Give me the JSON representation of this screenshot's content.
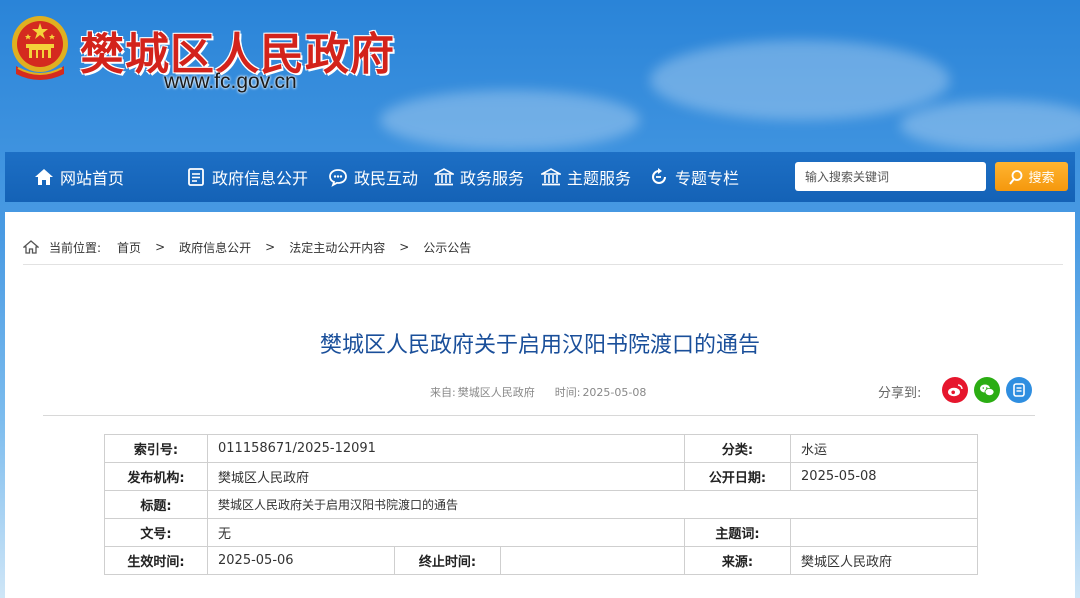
{
  "header": {
    "site_name": "樊城区人民政府",
    "domain": "www.fc.gov.cn",
    "brand_color": "#d3231b"
  },
  "nav": {
    "items": [
      {
        "label": "网站首页",
        "icon": "home-icon"
      },
      {
        "label": "政府信息公开",
        "icon": "document-list-icon"
      },
      {
        "label": "政民互动",
        "icon": "chat-bubble-icon"
      },
      {
        "label": "政务服务",
        "icon": "building-icon"
      },
      {
        "label": "主题服务",
        "icon": "building-icon"
      },
      {
        "label": "专题专栏",
        "icon": "refresh-icon"
      }
    ],
    "search_placeholder": "输入搜索关键词",
    "search_button": "搜索",
    "bar_color": "#1669bd",
    "search_button_color": "#f7a11c"
  },
  "breadcrumb": {
    "prefix": "当前位置:",
    "items": [
      "首页",
      "政府信息公开",
      "法定主动公开内容",
      "公示公告"
    ],
    "separator": ">"
  },
  "article": {
    "title": "樊城区人民政府关于启用汉阳书院渡口的通告",
    "source_label": "来自:",
    "source": "樊城区人民政府",
    "time_label": "时间:",
    "time": "2025-05-08",
    "share_label": "分享到:",
    "share_targets": [
      {
        "icon": "weibo-icon",
        "color": "#e6162d"
      },
      {
        "icon": "wechat-icon",
        "color": "#2bad13"
      },
      {
        "icon": "qzone-icon",
        "color": "#2f8ee0"
      }
    ],
    "title_color": "#1a4f9a"
  },
  "info": {
    "index_no_label": "索引号:",
    "index_no": "011158671/2025-12091",
    "category_label": "分类:",
    "category": "水运",
    "publisher_label": "发布机构:",
    "publisher": "樊城区人民政府",
    "publish_date_label": "公开日期:",
    "publish_date": "2025-05-08",
    "title_label": "标题:",
    "title": "樊城区人民政府关于启用汉阳书院渡口的通告",
    "doc_no_label": "文号:",
    "doc_no": "无",
    "keywords_label": "主题词:",
    "keywords": "",
    "effective_label": "生效时间:",
    "effective": "2025-05-06",
    "expiry_label": "终止时间:",
    "expiry": "",
    "source_label": "来源:",
    "source": "樊城区人民政府"
  }
}
